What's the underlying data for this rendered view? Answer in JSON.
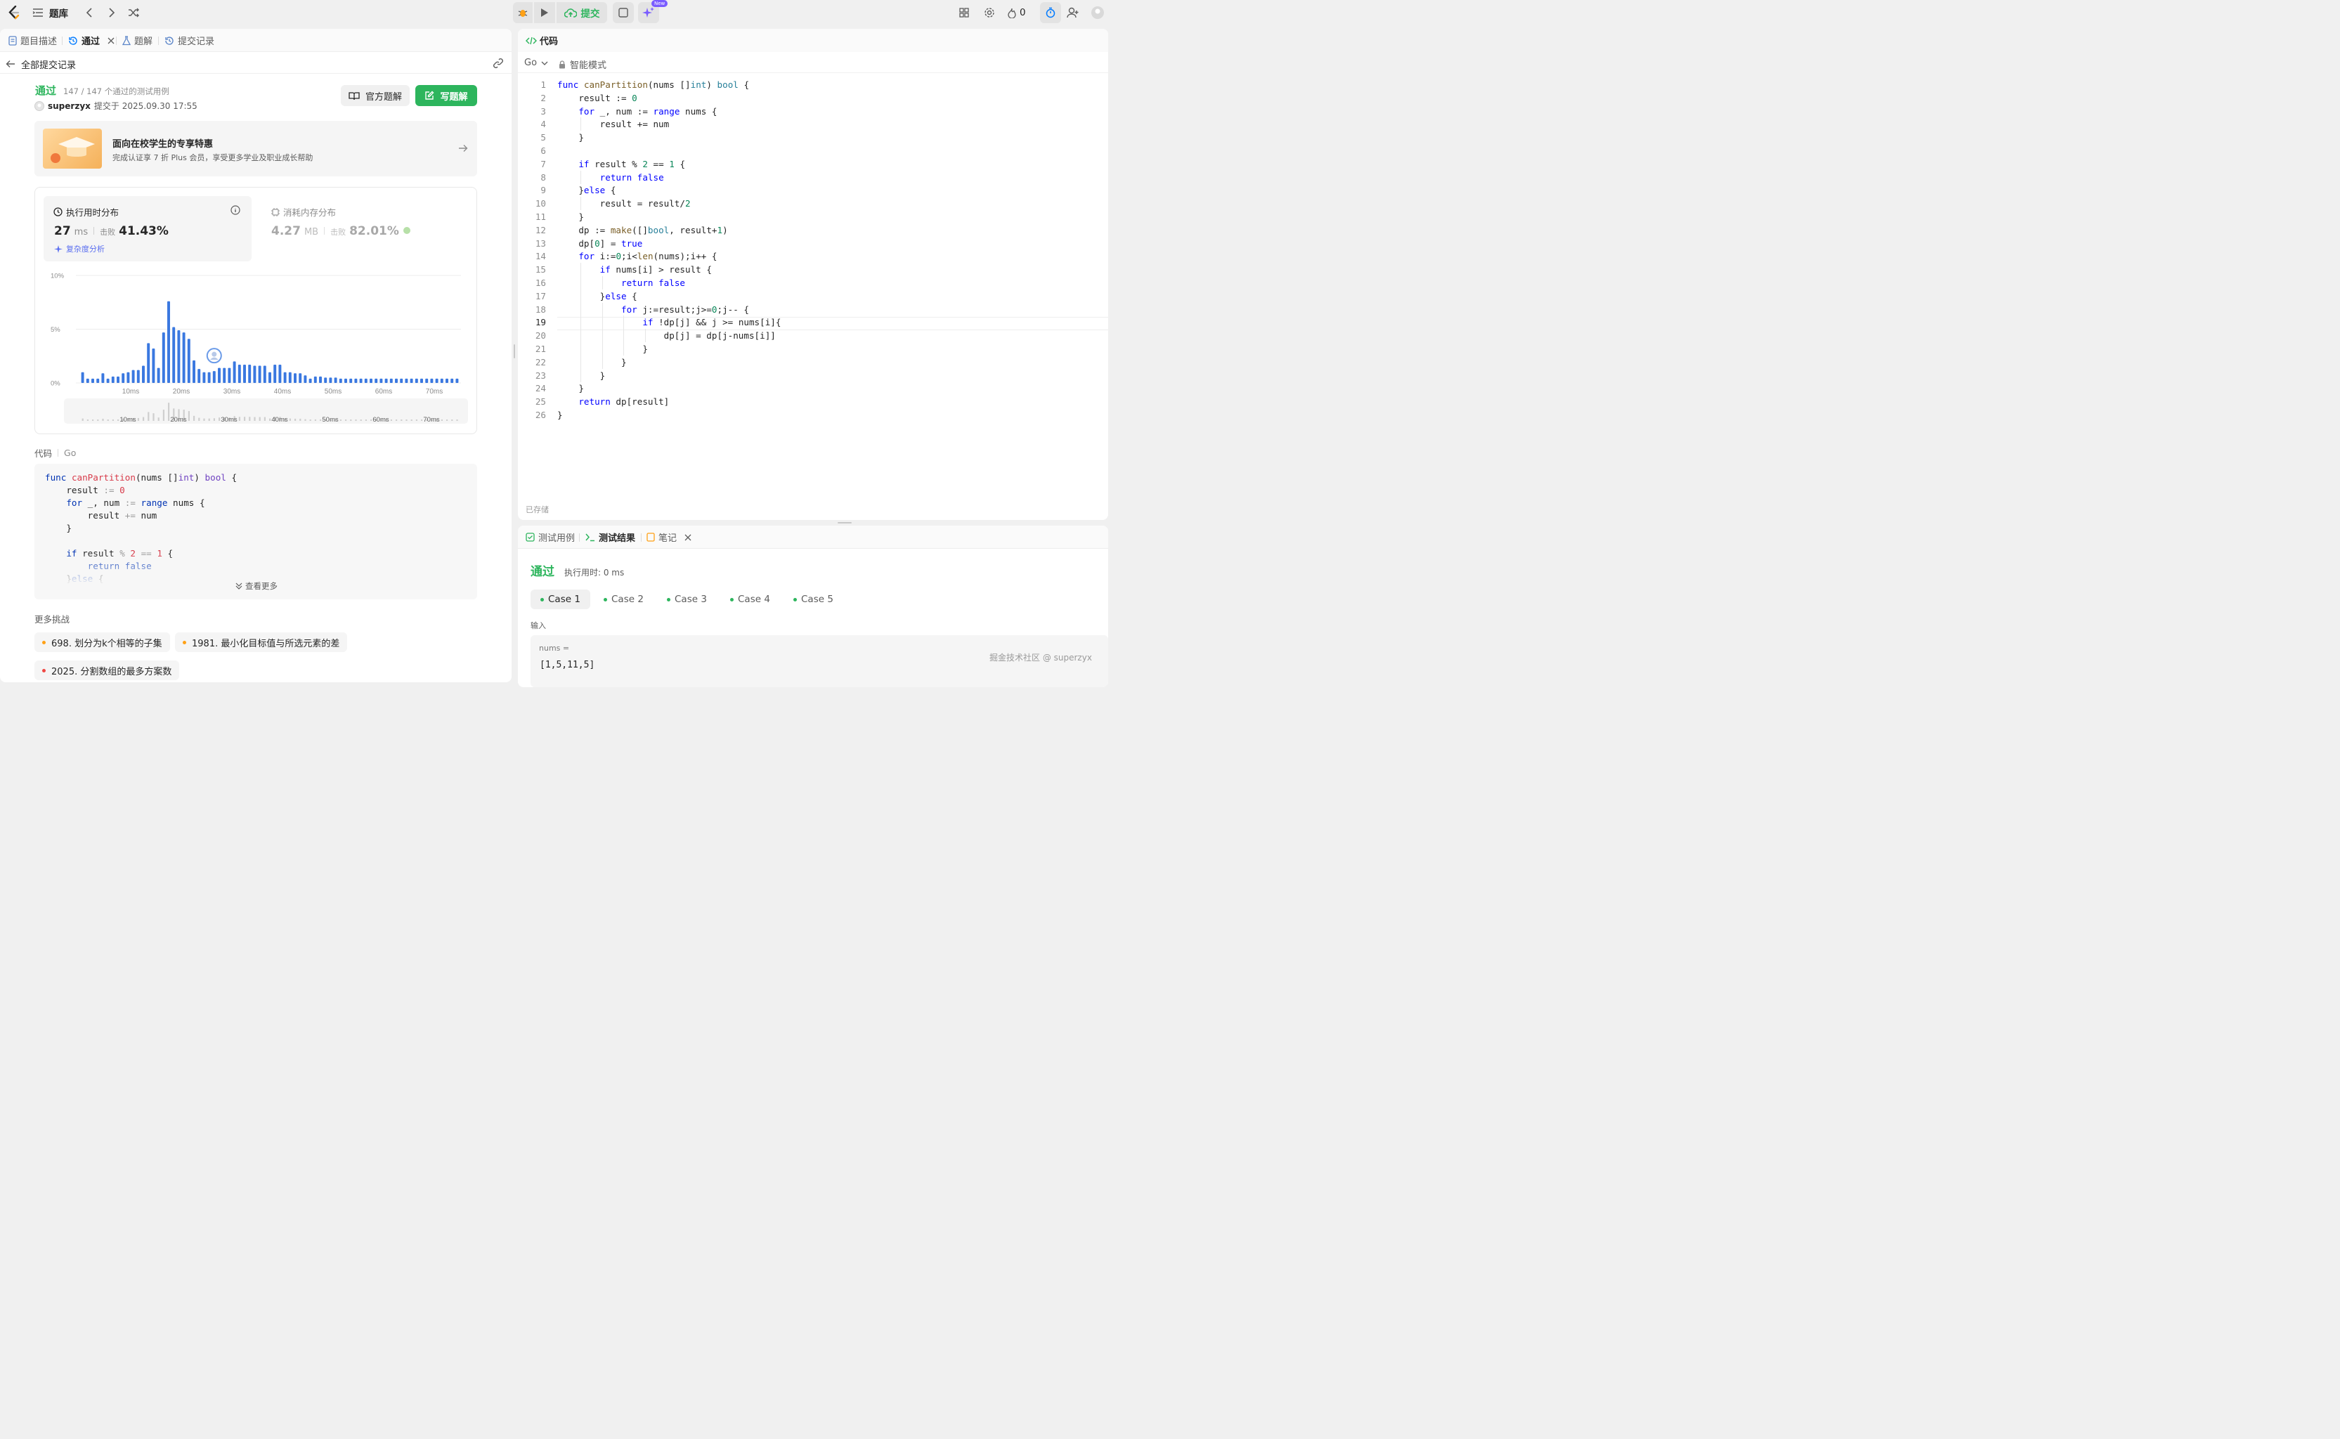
{
  "topbar": {
    "problem_bank_label": "题库",
    "submit_label": "提交",
    "new_badge": "New",
    "streak_count": "0"
  },
  "left_tabs": [
    {
      "label": "题目描述"
    },
    {
      "label": "通过"
    },
    {
      "label": "题解"
    },
    {
      "label": "提交记录"
    }
  ],
  "back_link": "全部提交记录",
  "submission": {
    "status": "通过",
    "testcases": "147 / 147 个通过的测试用例",
    "user": "superzyx",
    "submitted_at": "提交于 2025.09.30 17:55",
    "official_solution_label": "官方题解",
    "write_solution_label": "写题解"
  },
  "promo": {
    "title": "面向在校学生的专享特惠",
    "subtitle": "完成认证享 7 折 Plus 会员，享受更多学业及职业成长帮助"
  },
  "stats": {
    "runtime": {
      "title": "执行用时分布",
      "value": "27",
      "unit": "ms",
      "beats_label": "击败",
      "beats_value": "41.43%",
      "complexity_link": "复杂度分析"
    },
    "memory": {
      "title": "消耗内存分布",
      "value": "4.27",
      "unit": "MB",
      "beats_label": "击败",
      "beats_value": "82.01%"
    }
  },
  "chart_data": {
    "type": "bar",
    "title": "",
    "ylabel": "",
    "xlabel": "",
    "y_ticks": [
      "10%",
      "5%",
      "0%"
    ],
    "ylim": [
      0,
      10
    ],
    "x_ticks": [
      "10ms",
      "20ms",
      "30ms",
      "40ms",
      "50ms",
      "60ms",
      "70ms"
    ],
    "xlim": [
      0,
      75
    ],
    "bar_color": "#3a78e0",
    "grid": true,
    "current_user_marker_x_ms": 27,
    "series": [
      {
        "x": [
          1,
          2,
          3,
          4,
          5,
          6,
          7,
          8,
          9,
          10,
          11,
          12,
          13,
          14,
          15,
          16,
          17,
          18,
          19,
          20,
          21,
          22,
          23,
          24,
          25,
          26,
          27,
          28,
          29,
          30,
          31,
          32,
          33,
          34,
          35,
          36,
          37,
          38,
          39,
          40,
          41,
          42,
          43,
          44,
          45,
          46,
          47,
          48,
          49,
          50,
          51,
          52,
          53,
          54,
          55,
          56,
          57,
          58,
          59,
          60,
          61,
          62,
          63,
          64,
          65,
          66,
          67,
          68,
          69,
          70,
          71,
          72,
          73,
          74,
          75
        ],
        "values": [
          1.0,
          0.4,
          0.4,
          0.4,
          0.9,
          0.4,
          0.6,
          0.6,
          0.9,
          1.0,
          1.2,
          1.2,
          1.6,
          3.7,
          3.2,
          1.4,
          4.7,
          7.6,
          5.2,
          4.9,
          4.7,
          4.1,
          2.1,
          1.3,
          1.0,
          1.0,
          1.1,
          1.4,
          1.4,
          1.4,
          2.0,
          1.7,
          1.7,
          1.7,
          1.6,
          1.6,
          1.6,
          1.0,
          1.7,
          1.7,
          1.0,
          1.0,
          0.9,
          0.9,
          0.7,
          0.4,
          0.6,
          0.6,
          0.5,
          0.5,
          0.5,
          0.4,
          0.4,
          0.4,
          0.4,
          0.4,
          0.4,
          0.4,
          0.4,
          0.4,
          0.4,
          0.4,
          0.4,
          0.4,
          0.4,
          0.4,
          0.4,
          0.4,
          0.4,
          0.4,
          0.4,
          0.4,
          0.4,
          0.4,
          0.4
        ]
      }
    ]
  },
  "code_section": {
    "label": "代码",
    "language": "Go",
    "view_more": "查看更多",
    "lines": [
      "func canPartition(nums []int) bool {",
      "    result := 0",
      "    for _, num := range nums {",
      "        result += num",
      "    }",
      "",
      "    if result % 2 == 1 {",
      "        return false",
      "    }else {"
    ]
  },
  "more_challenges": {
    "title": "更多挑战",
    "items": [
      {
        "label": "698. 划分为k个相等的子集",
        "difficulty_color": "#ffa116"
      },
      {
        "label": "1981. 最小化目标值与所选元素的差",
        "difficulty_color": "#ffa116"
      },
      {
        "label": "2025. 分割数组的最多方案数",
        "difficulty_color": "#ef4743"
      }
    ]
  },
  "editor": {
    "title": "代码",
    "language": "Go",
    "mode": "智能模式",
    "saved": "已存储",
    "lines": [
      "func canPartition(nums []int) bool {",
      "    result := 0",
      "    for _, num := range nums {",
      "        result += num",
      "    }",
      "",
      "    if result % 2 == 1 {",
      "        return false",
      "    }else {",
      "        result = result/2",
      "    }",
      "    dp := make([]bool, result+1)",
      "    dp[0] = true",
      "    for i:=0;i<len(nums);i++ {",
      "        if nums[i] > result {",
      "            return false",
      "        }else {",
      "            for j:=result;j>=0;j-- {",
      "                if !dp[j] && j >= nums[i]{",
      "                    dp[j] = dp[j-nums[i]]",
      "                }",
      "            }",
      "        }",
      "    }",
      "    return dp[result]",
      "}"
    ]
  },
  "console": {
    "tabs": [
      {
        "label": "测试用例"
      },
      {
        "label": "测试结果"
      },
      {
        "label": "笔记"
      }
    ],
    "status": "通过",
    "runtime": "执行用时: 0 ms",
    "cases": [
      "Case 1",
      "Case 2",
      "Case 3",
      "Case 4",
      "Case 5"
    ],
    "input_label": "输入",
    "param_name": "nums =",
    "param_value": "[1,5,11,5]"
  },
  "watermark": "掘金技术社区 @ superzyx",
  "colors": {
    "accent_green": "#2db55d",
    "brand_orange": "#ffa116",
    "bar_blue": "#3a78e0",
    "link_blue": "#007aff"
  }
}
